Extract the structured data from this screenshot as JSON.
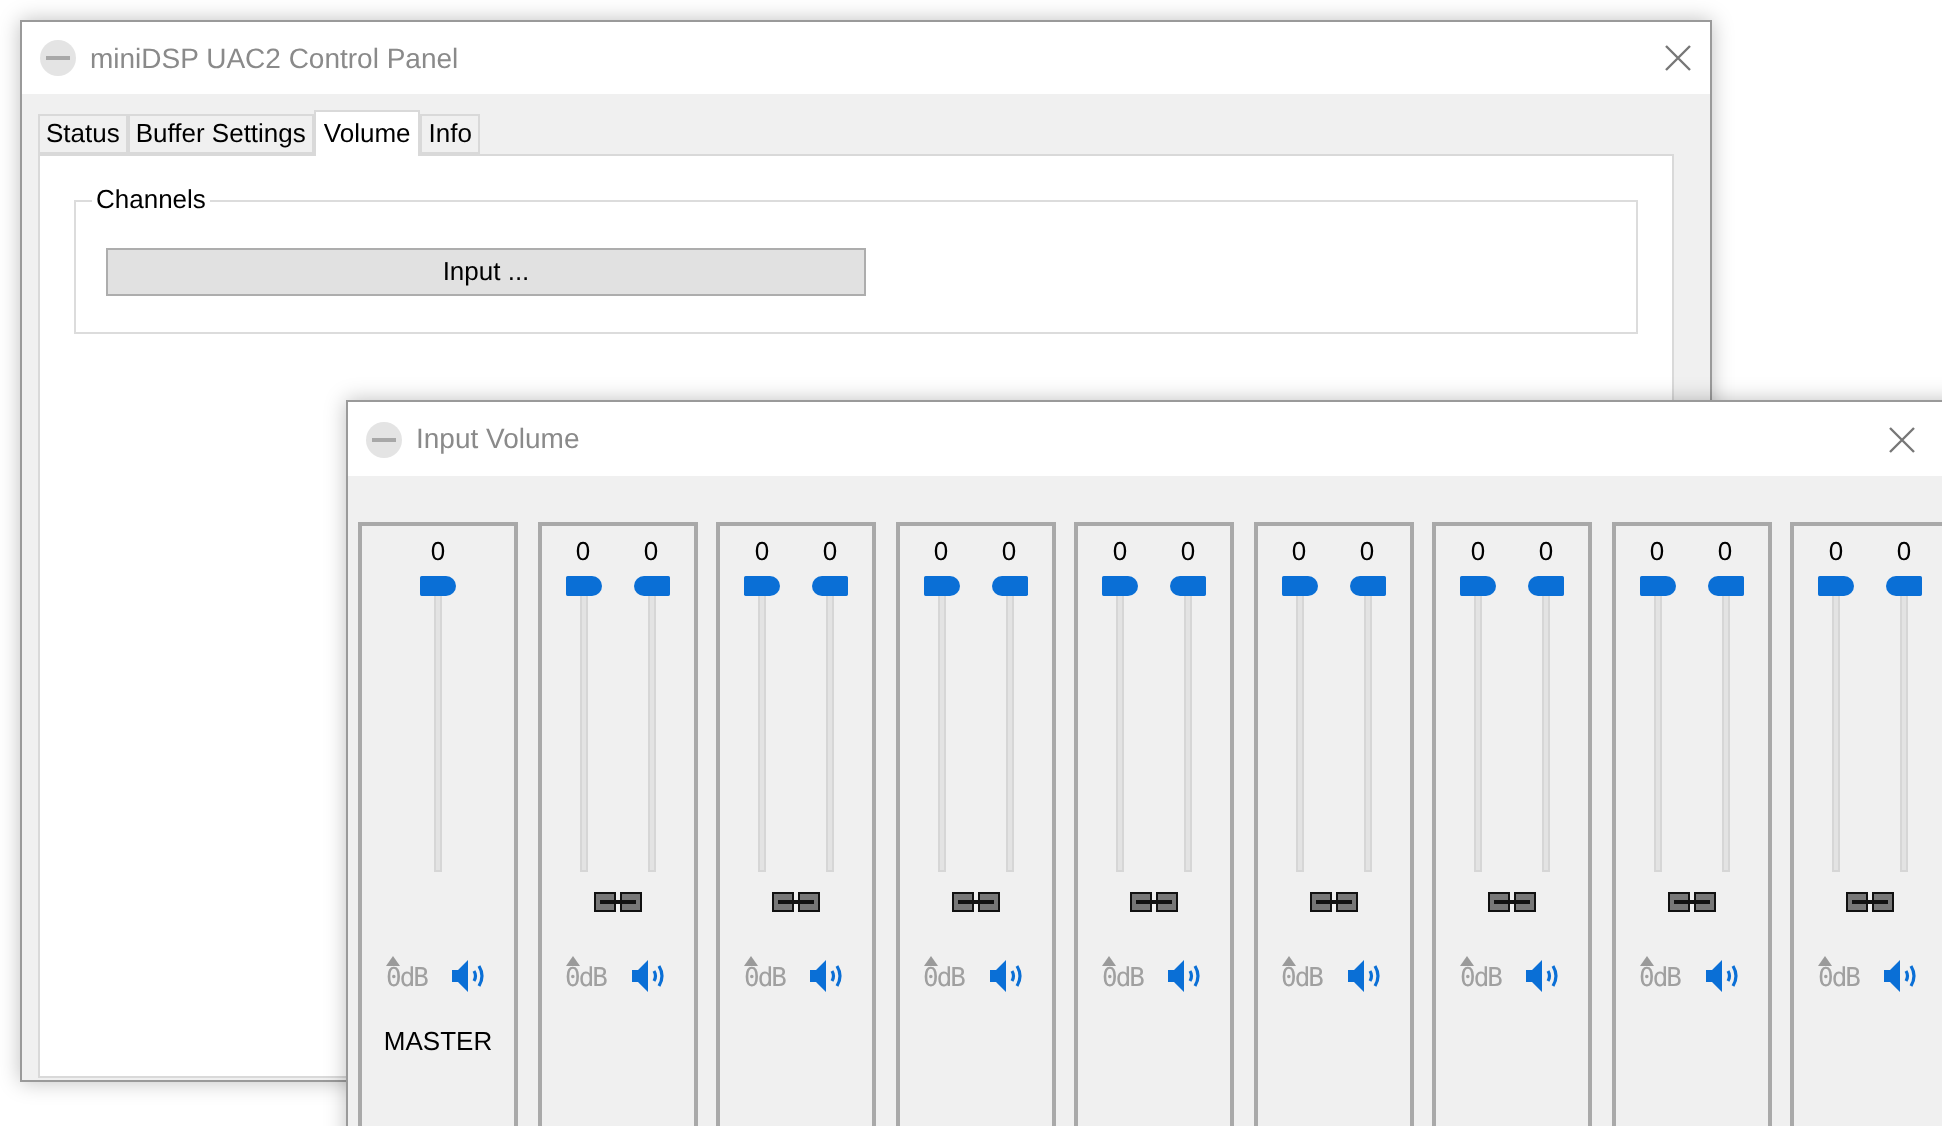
{
  "main_window": {
    "title": "miniDSP UAC2 Control Panel",
    "tabs": [
      {
        "label": "Status",
        "selected": false
      },
      {
        "label": "Buffer Settings",
        "selected": false
      },
      {
        "label": "Volume",
        "selected": true
      },
      {
        "label": "Info",
        "selected": false
      }
    ],
    "group": {
      "label": "Channels",
      "button": "Input ..."
    }
  },
  "volume_window": {
    "title": "Input Volume",
    "strips": [
      {
        "kind": "master",
        "sliders": [
          {
            "reading": "0",
            "level": 1
          }
        ],
        "zero_db": "0dB",
        "muted": false,
        "label": "MASTER"
      },
      {
        "kind": "stereo",
        "linked": true,
        "sliders": [
          {
            "reading": "0",
            "level": 1
          },
          {
            "reading": "0",
            "level": 1
          }
        ],
        "zero_db": "0dB",
        "muted": false
      },
      {
        "kind": "stereo",
        "linked": true,
        "sliders": [
          {
            "reading": "0",
            "level": 1
          },
          {
            "reading": "0",
            "level": 1
          }
        ],
        "zero_db": "0dB",
        "muted": false
      },
      {
        "kind": "stereo",
        "linked": true,
        "sliders": [
          {
            "reading": "0",
            "level": 1
          },
          {
            "reading": "0",
            "level": 1
          }
        ],
        "zero_db": "0dB",
        "muted": false
      },
      {
        "kind": "stereo",
        "linked": true,
        "sliders": [
          {
            "reading": "0",
            "level": 1
          },
          {
            "reading": "0",
            "level": 1
          }
        ],
        "zero_db": "0dB",
        "muted": false
      },
      {
        "kind": "stereo",
        "linked": true,
        "sliders": [
          {
            "reading": "0",
            "level": 1
          },
          {
            "reading": "0",
            "level": 1
          }
        ],
        "zero_db": "0dB",
        "muted": false
      },
      {
        "kind": "stereo",
        "linked": true,
        "sliders": [
          {
            "reading": "0",
            "level": 1
          },
          {
            "reading": "0",
            "level": 1
          }
        ],
        "zero_db": "0dB",
        "muted": false
      },
      {
        "kind": "stereo",
        "linked": true,
        "sliders": [
          {
            "reading": "0",
            "level": 1
          },
          {
            "reading": "0",
            "level": 1
          }
        ],
        "zero_db": "0dB",
        "muted": false
      },
      {
        "kind": "stereo",
        "linked": true,
        "sliders": [
          {
            "reading": "0",
            "level": 1
          },
          {
            "reading": "0",
            "level": 1
          }
        ],
        "zero_db": "0dB",
        "muted": false
      }
    ]
  }
}
